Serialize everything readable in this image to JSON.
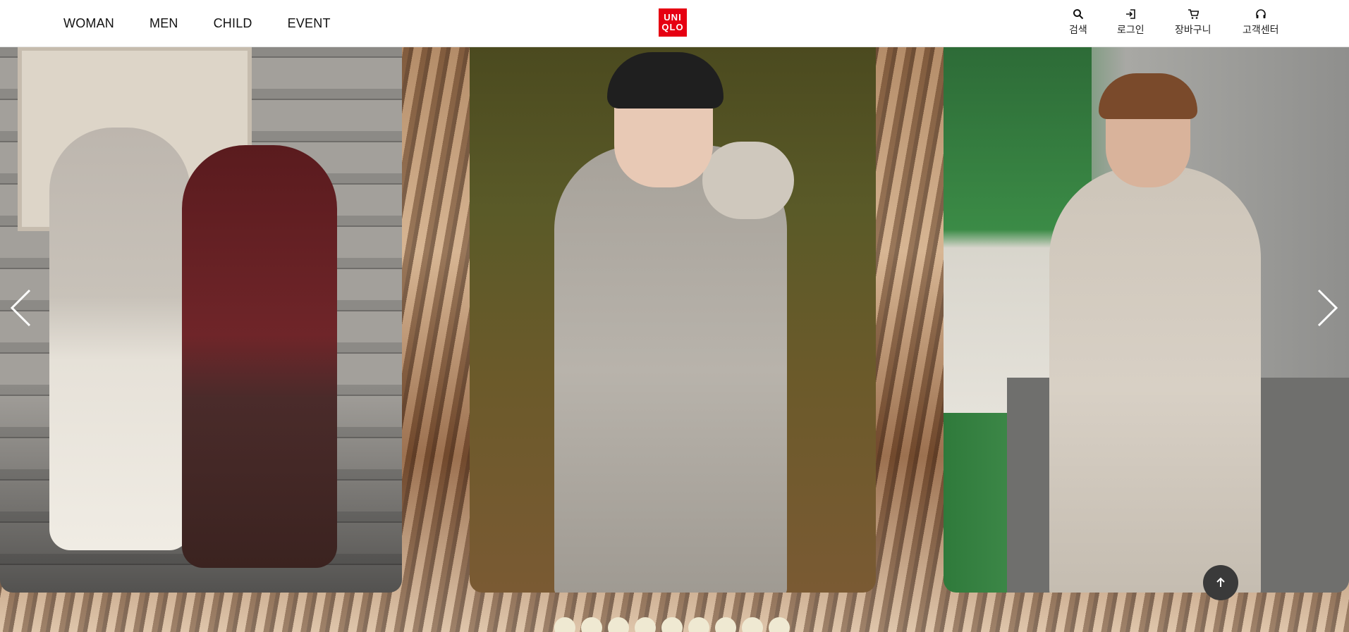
{
  "nav": {
    "items": [
      "WOMAN",
      "MEN",
      "CHILD",
      "EVENT"
    ]
  },
  "logo": {
    "line1": "UNI",
    "line2": "QLO",
    "color": "#e60012"
  },
  "utilities": {
    "search": {
      "label": "검색",
      "icon": "search-icon"
    },
    "login": {
      "label": "로그인",
      "icon": "login-icon"
    },
    "cart": {
      "label": "장바구니",
      "icon": "cart-icon"
    },
    "support": {
      "label": "고객센터",
      "icon": "headset-icon"
    }
  },
  "carousel": {
    "slide_count": 9,
    "prev_icon": "chevron-left-icon",
    "next_icon": "chevron-right-icon"
  },
  "back_to_top": {
    "icon": "arrow-up-icon"
  }
}
